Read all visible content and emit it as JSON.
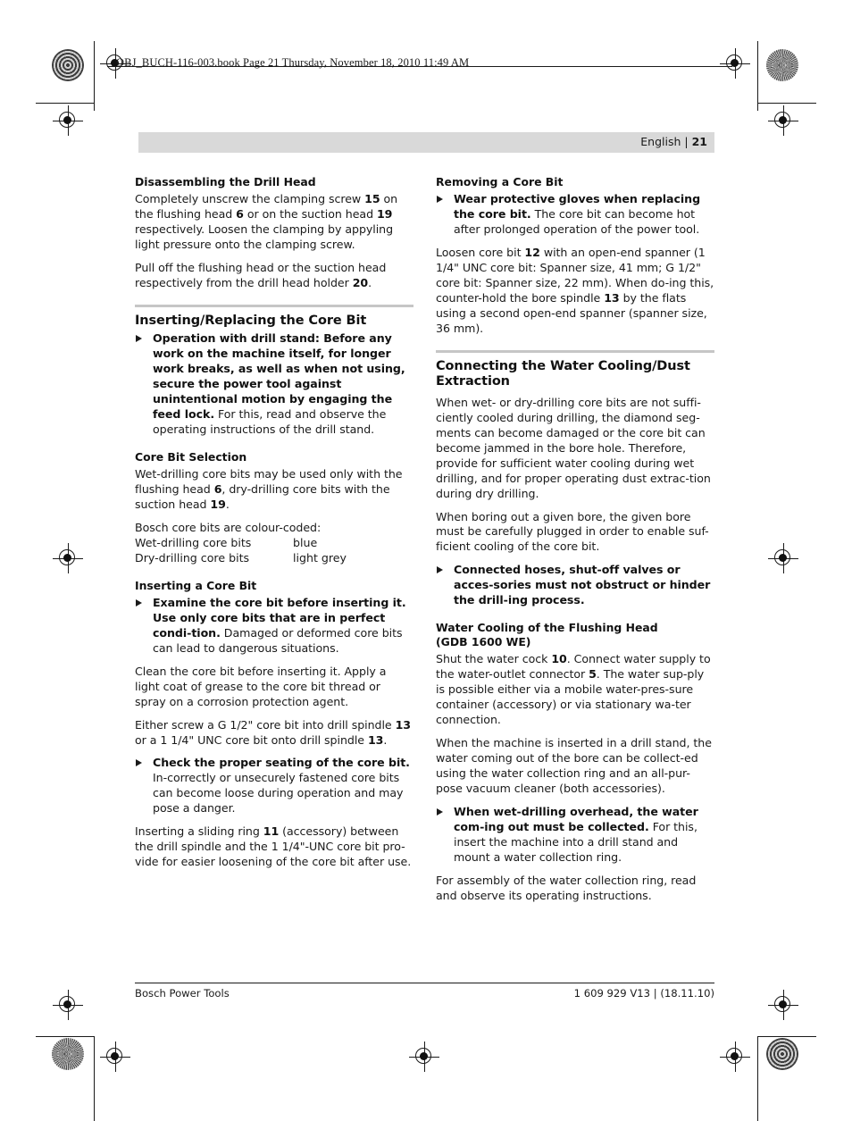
{
  "document": {
    "file_info": "OBJ_BUCH-116-003.book  Page 21  Thursday, November 18, 2010  11:49 AM",
    "running_head_language": "English",
    "running_head_separator": "|",
    "page_number": "21",
    "accent_bar_color": "#d9d9d9",
    "rule_color": "#c6c6c6"
  },
  "left_column": {
    "h2_disassembling": "Disassembling the Drill Head",
    "p_disassembling_1_a": "Completely unscrew the clamping screw ",
    "p_disassembling_1_b": "15",
    "p_disassembling_1_c": " on the flushing head ",
    "p_disassembling_1_d": "6",
    "p_disassembling_1_e": " or on the suction head ",
    "p_disassembling_1_f": "19",
    "p_disassembling_1_g": " respectively. Loosen the clamping by appyling light pressure onto the clamping screw.",
    "p_disassembling_2_a": "Pull off the flushing head or the suction head respectively from the drill head holder ",
    "p_disassembling_2_b": "20",
    "p_disassembling_2_c": ".",
    "h1_inserting_replacing": "Inserting/Replacing the Core Bit",
    "bullet_drill_stand_bold": "Operation with drill stand: Before any work on the machine itself, for longer work breaks, as well as when not using, secure the power tool against unintentional motion by engaging the feed lock.",
    "bullet_drill_stand_rest": " For this, read and observe the operating instructions of the drill stand.",
    "h2_core_bit_selection": "Core Bit Selection",
    "p_selection_a": "Wet-drilling core bits may be used only with the flushing head ",
    "p_selection_b": "6",
    "p_selection_c": ", dry-drilling core bits with the suction head ",
    "p_selection_d": "19",
    "p_selection_e": ".",
    "p_colour_coded": "Bosch core bits are colour-coded:",
    "colour_table": [
      {
        "type": "Wet-drilling core bits",
        "colour": "blue"
      },
      {
        "type": "Dry-drilling core bits",
        "colour": "light grey"
      }
    ],
    "h2_inserting_core_bit": "Inserting a Core Bit",
    "bullet_examine_bold": "Examine the core bit before inserting it. Use only core bits that are in perfect condi-tion.",
    "bullet_examine_rest": " Damaged or deformed core bits can lead to dangerous situations.",
    "p_clean": "Clean the core bit before inserting it. Apply a light coat of grease to the core bit thread or spray on a corrosion protection agent.",
    "p_either_screw_a": "Either screw a G 1/2\" core bit into drill spindle ",
    "p_either_screw_b": "13",
    "p_either_screw_c": " or a 1 1/4\" UNC core bit onto drill spindle ",
    "p_either_screw_d": "13",
    "p_either_screw_e": ".",
    "bullet_check_seating_bold": "Check the proper seating of the core bit.",
    "bullet_check_seating_rest": " In-correctly or unsecurely fastened core bits can become loose during operation and may pose a danger.",
    "p_sliding_ring_a": "Inserting a sliding ring ",
    "p_sliding_ring_b": "11",
    "p_sliding_ring_c": " (accessory) between the drill spindle and the 1 1/4\"-UNC core bit pro-vide for easier loosening of the core bit after use."
  },
  "right_column": {
    "h2_removing": "Removing a Core Bit",
    "bullet_gloves_bold": "Wear protective gloves when replacing the core bit.",
    "bullet_gloves_rest": " The core bit can become hot after prolonged operation of the power tool.",
    "p_loosen_a": "Loosen core bit ",
    "p_loosen_b": "12",
    "p_loosen_c": " with an open-end spanner (1 1/4\" UNC core bit: Spanner size, 41 mm; G 1/2\" core bit: Spanner size, 22 mm). When do-ing this, counter-hold the bore spindle ",
    "p_loosen_d": "13",
    "p_loosen_e": " by the flats using a second open-end spanner (spanner size, 36 mm).",
    "h1_connecting": "Connecting the Water Cooling/Dust Extraction",
    "p_when_wet": "When wet- or dry-drilling core bits are not suffi-ciently cooled during drilling, the diamond seg-ments can become damaged or the core bit can become jammed in the bore hole. Therefore, provide for sufficient water cooling during wet drilling, and for proper operating dust extrac-tion during dry drilling.",
    "p_when_boring": "When boring out a given bore, the given bore must be carefully plugged in order to enable suf-ficient cooling of the core bit.",
    "bullet_hoses_bold": "Connected hoses, shut-off valves or acces-sories must not obstruct or hinder the drill-ing process.",
    "h2_water_cooling_line1": "Water Cooling of the Flushing Head",
    "h2_water_cooling_line2": "(GDB 1600 WE)",
    "p_shut_a": "Shut the water cock ",
    "p_shut_b": "10",
    "p_shut_c": ". Connect water supply to the water-outlet connector ",
    "p_shut_d": "5",
    "p_shut_e": ". The water sup-ply is possible either via a mobile water-pres-sure container (accessory) or via stationary wa-ter connection.",
    "p_machine_inserted": "When the machine is inserted in a drill stand, the water coming out of the bore can be collect-ed using the water collection ring and an all-pur-pose vacuum cleaner (both accessories).",
    "bullet_overhead_bold": "When wet-drilling overhead, the water com-ing out must be collected.",
    "bullet_overhead_rest": " For this, insert the machine into a drill stand and mount a water collection ring.",
    "p_assembly": "For assembly of the water collection ring, read and observe its operating instructions."
  },
  "footer": {
    "left": "Bosch Power Tools",
    "right": "1 609 929 V13 | (18.11.10)"
  }
}
